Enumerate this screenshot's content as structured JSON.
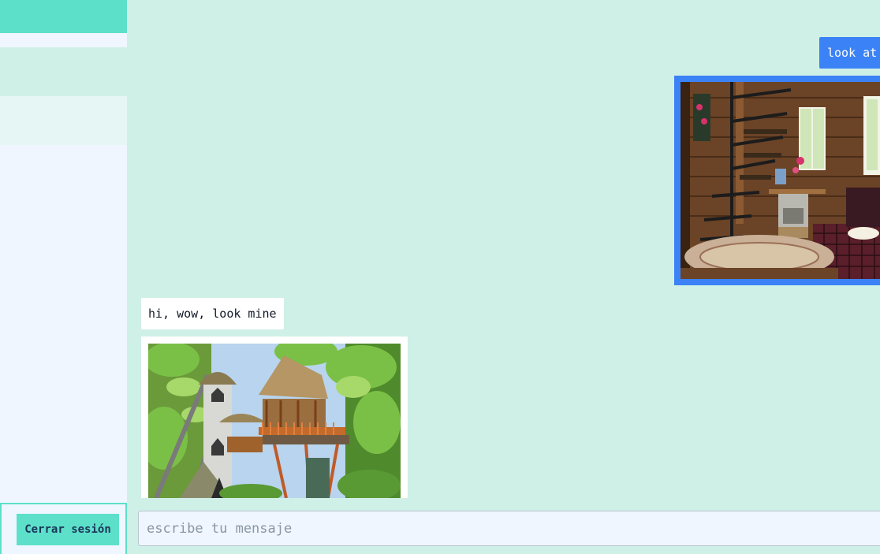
{
  "sidebar": {
    "logout_label": "Cerrar sesión"
  },
  "messages": [
    {
      "direction": "outgoing",
      "kind": "text",
      "text": "look at"
    },
    {
      "direction": "outgoing",
      "kind": "image",
      "subject": "wooden-cabin-interior"
    },
    {
      "direction": "incoming",
      "kind": "text",
      "text": "hi, wow, look mine"
    },
    {
      "direction": "incoming",
      "kind": "image",
      "subject": "jungle-treehouse"
    }
  ],
  "composer": {
    "placeholder": "escribe tu mensaje",
    "value": ""
  },
  "colors": {
    "accent": "#5de0c9",
    "chat_background": "#cff0e6",
    "outgoing_bubble": "#3b82f6",
    "incoming_bubble": "#ffffff",
    "sidebar_background": "#eff6ff"
  }
}
